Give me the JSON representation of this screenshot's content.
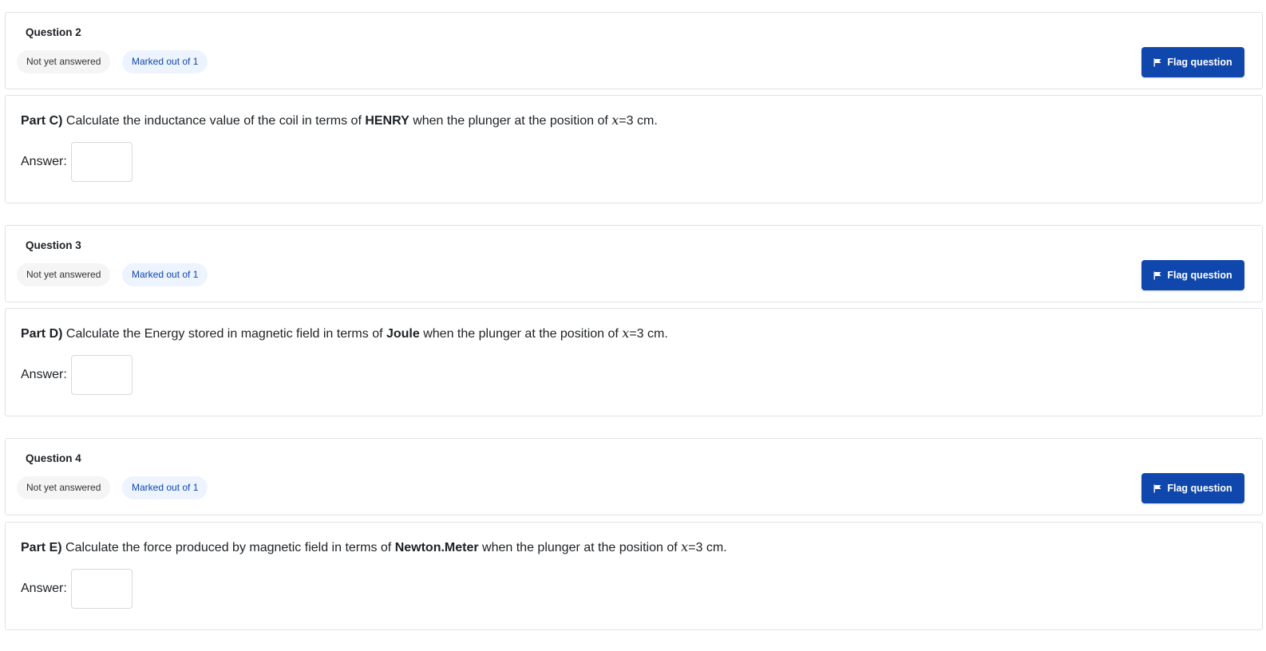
{
  "questions": [
    {
      "title": "Question 2",
      "state": "Not yet answered",
      "mark": "Marked out of 1",
      "flag_label": "Flag question",
      "part_label": "Part C)",
      "text_before": " Calculate the inductance value of the coil in terms of ",
      "unit": "HENRY",
      "text_after": " when the plunger at the position of ",
      "variable": "x",
      "value": "=3 cm.",
      "answer_label": "Answer:",
      "answer_value": ""
    },
    {
      "title": "Question 3",
      "state": "Not yet answered",
      "mark": "Marked out of 1",
      "flag_label": "Flag question",
      "part_label": "Part D)",
      "text_before": " Calculate the Energy stored in magnetic field in terms of ",
      "unit": "Joule",
      "text_after": " when the plunger at the position of ",
      "variable": "x",
      "value": "=3 cm.",
      "answer_label": "Answer:",
      "answer_value": ""
    },
    {
      "title": "Question 4",
      "state": "Not yet answered",
      "mark": "Marked out of 1",
      "flag_label": "Flag question",
      "part_label": "Part E)",
      "text_before": " Calculate the force produced by magnetic field in terms of ",
      "unit": "Newton.Meter",
      "text_after": " when the plunger at the position of ",
      "variable": "x",
      "value": "=3 cm.",
      "answer_label": "Answer:",
      "answer_value": ""
    }
  ],
  "icons": {
    "flag": "flag-icon"
  },
  "colors": {
    "primary": "#0f47ad",
    "mark_badge_bg": "#edf4ff",
    "state_badge_bg": "#f5f5f5",
    "border": "#dee2e6"
  }
}
